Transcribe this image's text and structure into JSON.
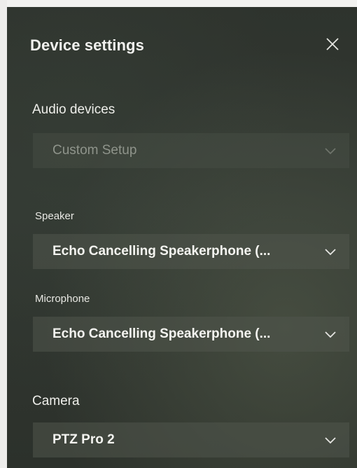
{
  "panel": {
    "title": "Device settings",
    "close_icon": "close-icon"
  },
  "audio": {
    "section_label": "Audio devices",
    "selected": "Custom Setup",
    "disabled": true
  },
  "speaker": {
    "label": "Speaker",
    "selected": "Echo Cancelling Speakerphone (..."
  },
  "microphone": {
    "label": "Microphone",
    "selected": "Echo Cancelling Speakerphone (..."
  },
  "camera": {
    "section_label": "Camera",
    "selected": "PTZ Pro 2"
  },
  "colors": {
    "panel_background": "#2e332d",
    "dropdown_background": "#50564c",
    "text_primary": "#f1f1ee",
    "text_disabled": "#8f948b"
  },
  "icons": {
    "dropdown": "chevron-down-icon"
  }
}
